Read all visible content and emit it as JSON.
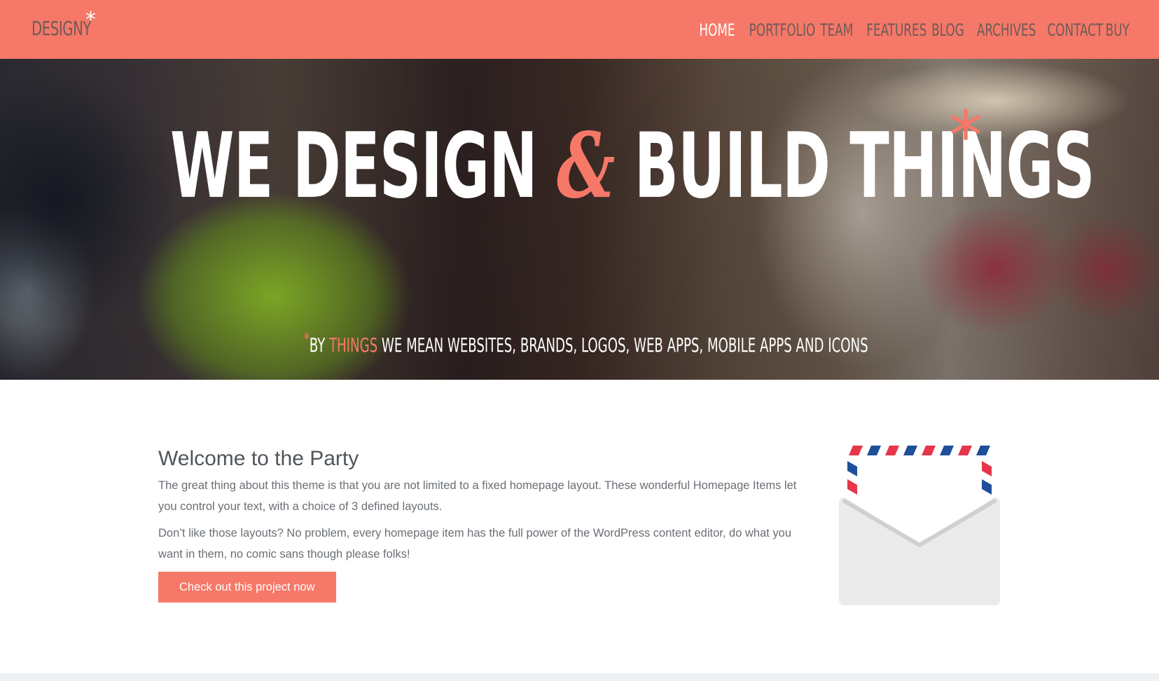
{
  "header": {
    "logo_text": "DESIGNY",
    "logo_star": "*",
    "nav": [
      {
        "label": "HOME",
        "active": true
      },
      {
        "label": "PORTFOLIO",
        "active": false
      },
      {
        "label": "TEAM",
        "active": false
      },
      {
        "label": "FEATURES",
        "active": false
      },
      {
        "label": "BLOG",
        "active": false
      },
      {
        "label": "ARCHIVES",
        "active": false
      },
      {
        "label": "CONTACT",
        "active": false
      },
      {
        "label": "BUY",
        "active": false
      }
    ]
  },
  "hero": {
    "title_part1": "WE DESIGN ",
    "title_amp": "&",
    "title_part2": " BUILD THINGS",
    "title_star": "*",
    "sub_star": "*",
    "sub_by": "BY ",
    "sub_accent": "THINGS",
    "sub_rest": " WE MEAN WEBSITES, BRANDS, LOGOS, WEB APPS, MOBILE APPS AND ICONS"
  },
  "content": {
    "title": "Welcome to the Party",
    "paragraph1": "The great thing about this theme is that you are not limited to a fixed homepage layout. These wonderful Homepage Items let you control your text, with a choice of 3 defined layouts.",
    "paragraph2": "Don’t like those layouts? No problem, every homepage item has the full power of the WordPress content editor, do what you want in them, no comic sans though please folks!",
    "cta_label": "Check out this project now",
    "illustration_icon": "envelope-icon"
  },
  "colors": {
    "accent": "#f67868",
    "nav_text": "#6b5b58",
    "heading": "#4f555b",
    "body_text": "#6a6f74",
    "envelope": "#ebebeb",
    "airmail_red": "#e5364a",
    "airmail_blue": "#1f4f9a"
  }
}
